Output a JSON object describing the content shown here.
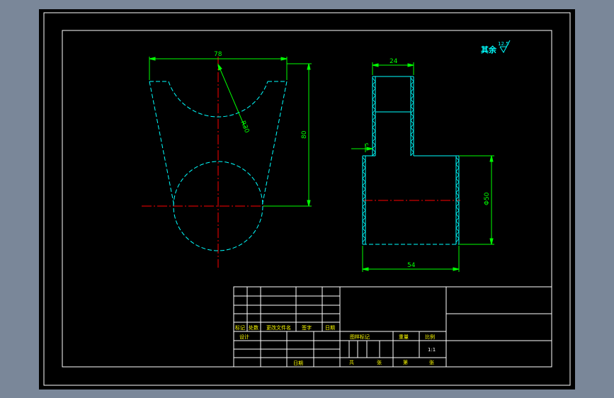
{
  "colors": {
    "background": "#000000",
    "frame": "#ffffff",
    "dimension": "#00ff00",
    "outline": "#00ffff",
    "centerline": "#ff0000",
    "window_backdrop": "#778599"
  },
  "surface_finish": {
    "label": "其余",
    "value": "12.5",
    "symbol_name": "roughness-symbol-icon"
  },
  "front_view": {
    "dim_width": "78",
    "dim_height": "80",
    "dim_radius": "R30"
  },
  "side_view": {
    "dim_top_width": "24",
    "dim_step": "5",
    "dim_diameter": "Φ50",
    "dim_bottom_width": "54"
  },
  "title_block": {
    "rev_headers": [
      "标记",
      "处数",
      "更改文件名",
      "签字",
      "日期"
    ],
    "design_label": "设计",
    "date_label": "日期",
    "stage_label": "图样标记",
    "weight_label": "重量",
    "scale_label": "比例",
    "scale_value": "1:1",
    "total_label": "共",
    "sheet_label": "张",
    "page_label": "第",
    "page_sheet_label": "张"
  }
}
